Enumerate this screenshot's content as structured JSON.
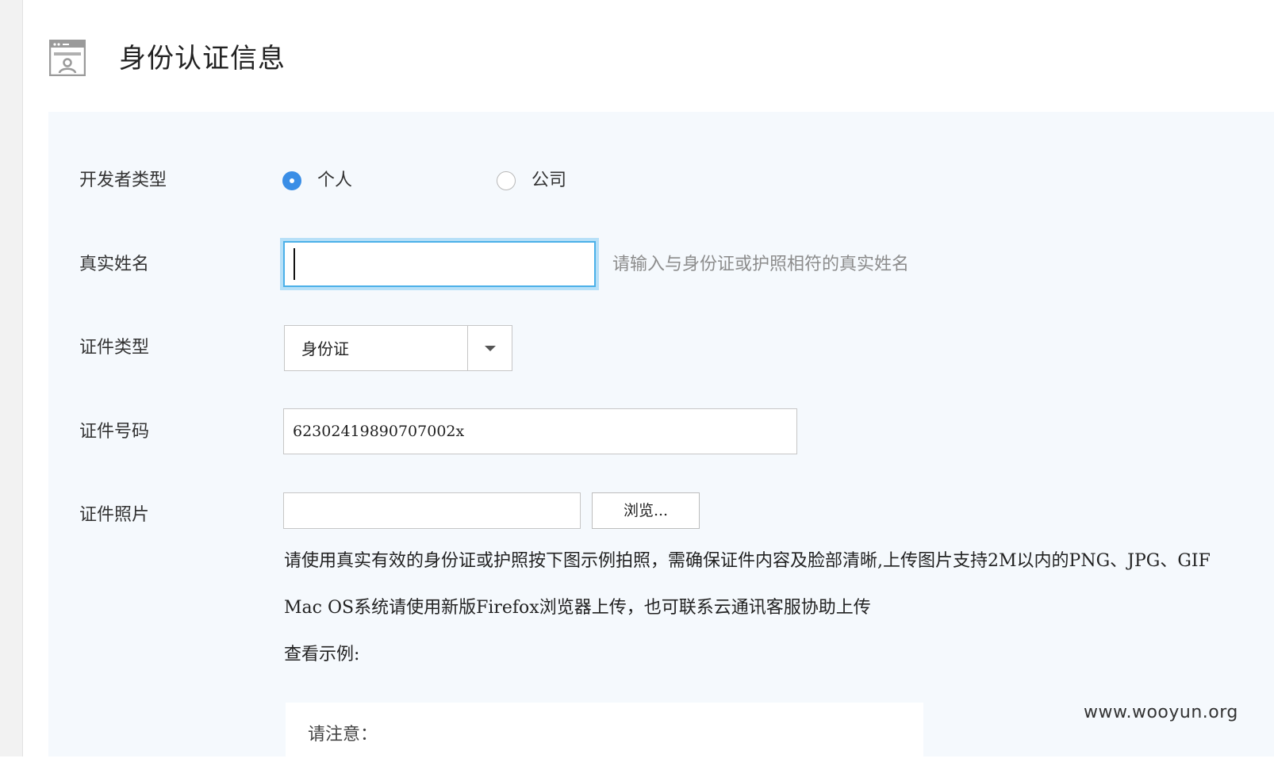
{
  "header": {
    "title": "身份认证信息",
    "icon": "id-card-icon"
  },
  "form": {
    "developer_type": {
      "label": "开发者类型",
      "options": [
        {
          "label": "个人",
          "selected": true
        },
        {
          "label": "公司",
          "selected": false
        }
      ]
    },
    "real_name": {
      "label": "真实姓名",
      "value": "",
      "hint": "请输入与身份证或护照相符的真实姓名"
    },
    "id_type": {
      "label": "证件类型",
      "selected": "身份证"
    },
    "id_number": {
      "label": "证件号码",
      "value": "62302419890707002x"
    },
    "id_photo": {
      "label": "证件照片",
      "value": "",
      "browse_label": "浏览...",
      "instructions": [
        "请使用真实有效的身份证或护照按下图示例拍照，需确保证件内容及脸部清晰,上传图片支持2M以内的PNG、JPG、GIF",
        "Mac OS系统请使用新版Firefox浏览器上传，也可联系云通讯客服协助上传",
        "查看示例:"
      ]
    },
    "notice": "请注意："
  },
  "watermark": "www.wooyun.org",
  "colors": {
    "accent": "#3a8ee6",
    "focus_border": "#4bb0e8",
    "panel_bg": "#f5f9fd"
  }
}
